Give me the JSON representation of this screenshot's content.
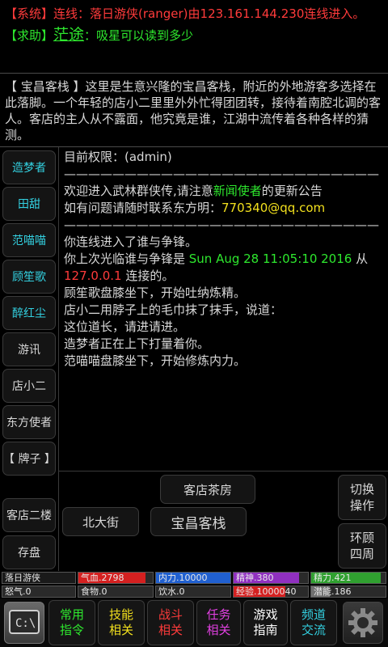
{
  "chat": {
    "line1": {
      "tag": "【系统】",
      "prefix": "连线：",
      "name": "落日游侠(ranger)",
      "suffix": "由123.161.144.230连线进入。"
    },
    "line2": {
      "tag": "【求助】",
      "user": "茫途",
      "sep": "：",
      "text": "吸星可以读到多少"
    }
  },
  "room": {
    "text": "【 宝昌客栈 】这里是生意兴隆的宝昌客栈，附近的外地游客多选择在此落脚。一个年轻的店小二里里外外忙得团团转，接待着南腔北调的客人。客店的主人从不露面，他究竟是谁，江湖中流传着各种各样的猜测。"
  },
  "npcs": [
    "造梦者",
    "田甜",
    "范喵喵",
    "顾笙歌",
    "醉红尘",
    "游讯",
    "店小二",
    "东方使者",
    "【 牌子 】"
  ],
  "side_buttons": [
    "客店二楼",
    "存盘"
  ],
  "messages": {
    "m1": "目前权限：(admin)",
    "sep1": "——————————————————————————",
    "m2a": "欢迎进入武林群侠传,请注意",
    "m2b": "新闻使者",
    "m2c": "的更新公告",
    "m3a": "如有问题请随时联系东方明：",
    "m3b": "770340@qq.com",
    "sep2": "——————————————————————————",
    "m4": "你连线进入了谁与争锋。",
    "m5a": "你上次光临谁与争锋是 ",
    "m5b": "Sun Aug 28 11:05:10 2016",
    "m5c": " 从",
    "m6a": "127.0.0.1",
    "m6b": " 连接的。",
    "m7": "顾笙歌盘膝坐下，开始吐纳炼精。",
    "m8": "店小二用脖子上的毛巾抹了抹手，说道：",
    "m9": "这位道长，请进请进。",
    "m10": "造梦者正在上下打量着你。",
    "m11": "范喵喵盘膝坐下，开始修炼内力。"
  },
  "exits": {
    "north": "客店茶房",
    "west": "北大街",
    "center": "宝昌客栈",
    "switch": "切换操作",
    "look": "环顾四周"
  },
  "status": {
    "name": "落日游侠",
    "qixue": "气血.2798",
    "neili": "内力.10000",
    "jingshen": "精神.380",
    "jingli": "精力.421",
    "nuqi": "怒气.0",
    "shiwu": "食物.0",
    "yinshui": "饮水.0",
    "jingyan": "经验.1000040",
    "qianneng": "潜能.186",
    "levels": {
      "qixue": 0.9,
      "neili": 1.0,
      "jingshen": 0.88,
      "jingli": 0.93,
      "jingyan": 0.7,
      "qianneng": 0.25
    }
  },
  "toolbar": {
    "left_icon": "terminal-icon",
    "right_icon": "gear-icon",
    "items": [
      {
        "l1": "常用",
        "l2": "指令",
        "color": "#2ee82e"
      },
      {
        "l1": "技能",
        "l2": "相关",
        "color": "#f2e01d"
      },
      {
        "l1": "战斗",
        "l2": "相关",
        "color": "#ff3b3b"
      },
      {
        "l1": "任务",
        "l2": "相关",
        "color": "#e040e0"
      },
      {
        "l1": "游戏",
        "l2": "指南",
        "color": "#ffffff"
      },
      {
        "l1": "频道",
        "l2": "交流",
        "color": "#33d0e0"
      }
    ]
  },
  "colors": {
    "qixue": "#d42020",
    "neili": "#2060d0",
    "jingshen": "#9030c0",
    "jingli": "#30a030",
    "jingyan": "#d42020",
    "qianneng": "#707070"
  }
}
